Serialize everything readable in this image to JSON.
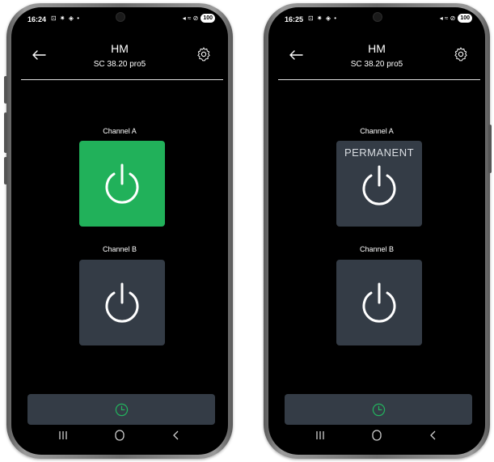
{
  "colors": {
    "channel_on": "#21b15a",
    "channel_off": "#343c46",
    "clock_accent": "#23b35e",
    "screen_bg": "#000000"
  },
  "screens": [
    {
      "status": {
        "time": "16:24",
        "icons": "⊡ ✷ ◈ •",
        "signal": "◂ ≈ ⊘",
        "battery": "100"
      },
      "header": {
        "title": "HM",
        "subtitle": "SC 38.20 pro5",
        "back_icon": "arrow-left-icon",
        "settings_icon": "gear-icon"
      },
      "channels": [
        {
          "label": "Channel A",
          "state": "on",
          "badge": ""
        },
        {
          "label": "Channel B",
          "state": "off",
          "badge": ""
        }
      ],
      "bottom_icon": "clock-icon",
      "nav": [
        "recent-apps-icon",
        "home-icon",
        "back-icon"
      ]
    },
    {
      "status": {
        "time": "16:25",
        "icons": "⊡ ✷ ◈ •",
        "signal": "◂ ≈ ⊘",
        "battery": "100"
      },
      "header": {
        "title": "HM",
        "subtitle": "SC 38.20 pro5",
        "back_icon": "arrow-left-icon",
        "settings_icon": "gear-icon"
      },
      "channels": [
        {
          "label": "Channel A",
          "state": "off",
          "badge": "PERMANENT"
        },
        {
          "label": "Channel B",
          "state": "off",
          "badge": ""
        }
      ],
      "bottom_icon": "clock-icon",
      "nav": [
        "recent-apps-icon",
        "home-icon",
        "back-icon"
      ]
    }
  ]
}
